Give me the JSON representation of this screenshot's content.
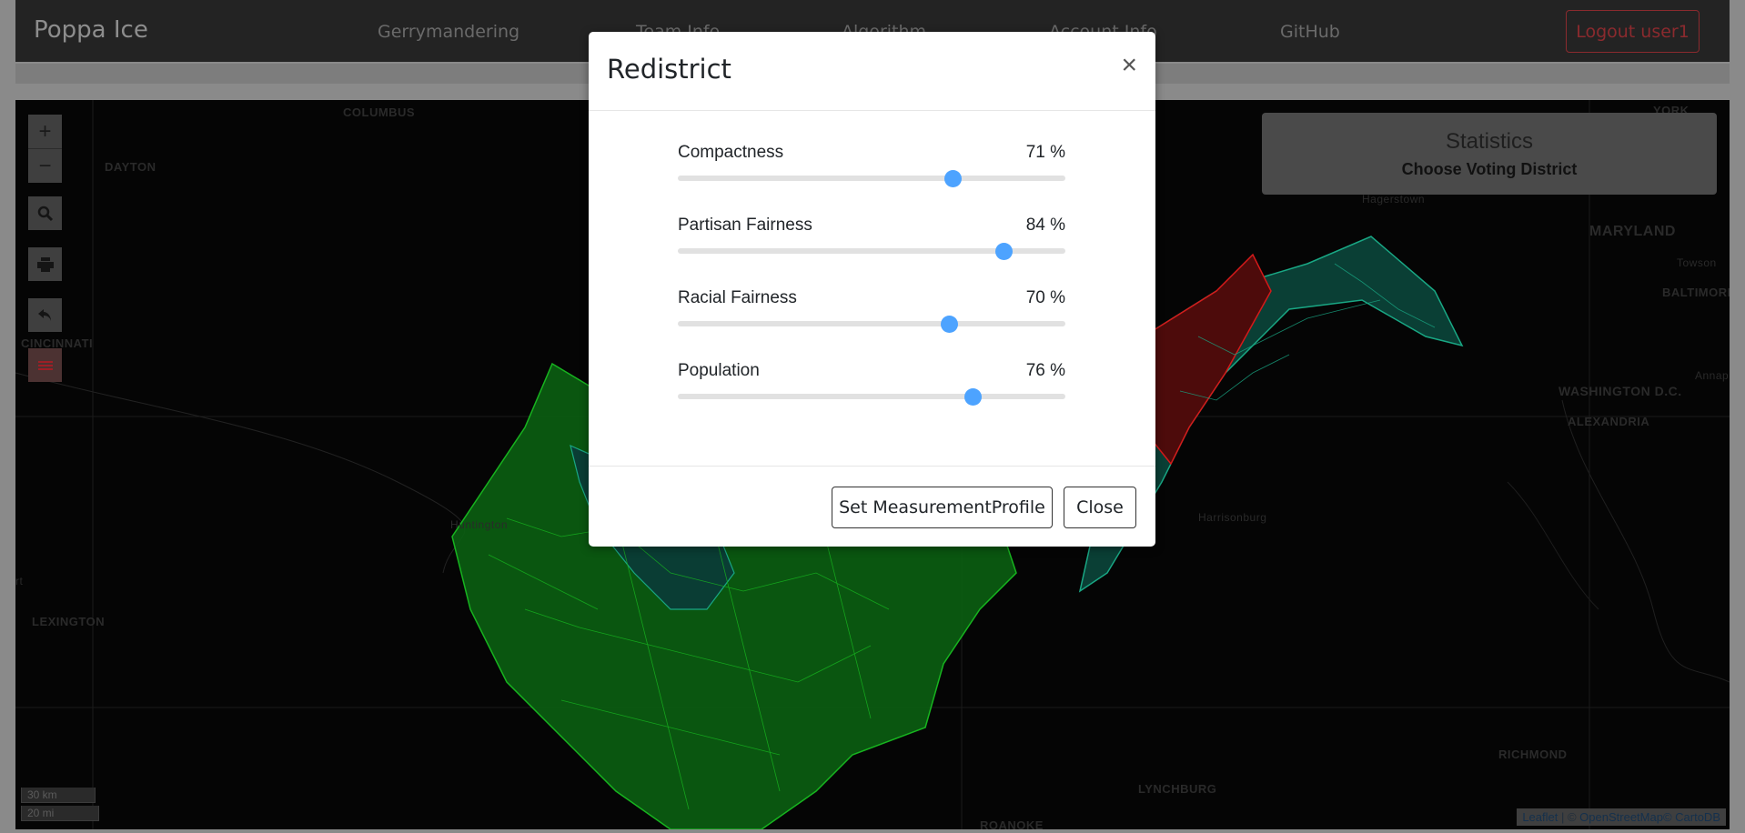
{
  "navbar": {
    "brand": "Poppa Ice",
    "links": [
      "Gerrymandering",
      "Team Info",
      "Algorithm",
      "Account Info",
      "GitHub"
    ],
    "logout_label": "Logout user1"
  },
  "map": {
    "cities": [
      "COLUMBUS",
      "DAYTON",
      "CINCINNATI",
      "LEXINGTON",
      "YORK",
      "MARYLAND",
      "BALTIMORE",
      "WASHINGTON D.C.",
      "ALEXANDRIA",
      "RICHMOND",
      "LYNCHBURG",
      "ROANOKE"
    ],
    "small_labels": [
      "Hagerstown",
      "Towson",
      "Annap",
      "Harrisonburg",
      "Huntington",
      "rt"
    ],
    "zoom_in": "+",
    "zoom_out": "−",
    "scale_km": "30 km",
    "scale_mi": "20 mi",
    "attribution": {
      "leaflet": "Leaflet",
      "sep": " | © ",
      "osm": "OpenStreetMap",
      "carto": "© CartoDB"
    },
    "colors": {
      "green": "#0d7a14",
      "green_line": "#17c21f",
      "teal": "#0b4a3c",
      "teal_line": "#18a27f",
      "red": "#5a0d0d",
      "red_line": "#d21818"
    }
  },
  "statistics": {
    "title": "Statistics",
    "subtitle": "Choose Voting District"
  },
  "modal": {
    "title": "Redistrict",
    "close_symbol": "×",
    "sliders": [
      {
        "label": "Compactness",
        "value": 71,
        "display": "71 %"
      },
      {
        "label": "Partisan Fairness",
        "value": 84,
        "display": "84 %"
      },
      {
        "label": "Racial Fairness",
        "value": 70,
        "display": "70 %"
      },
      {
        "label": "Population",
        "value": 76,
        "display": "76 %"
      }
    ],
    "set_button": "Set MeasurementProfile",
    "close_button": "Close",
    "accent": "#4da3ff"
  }
}
